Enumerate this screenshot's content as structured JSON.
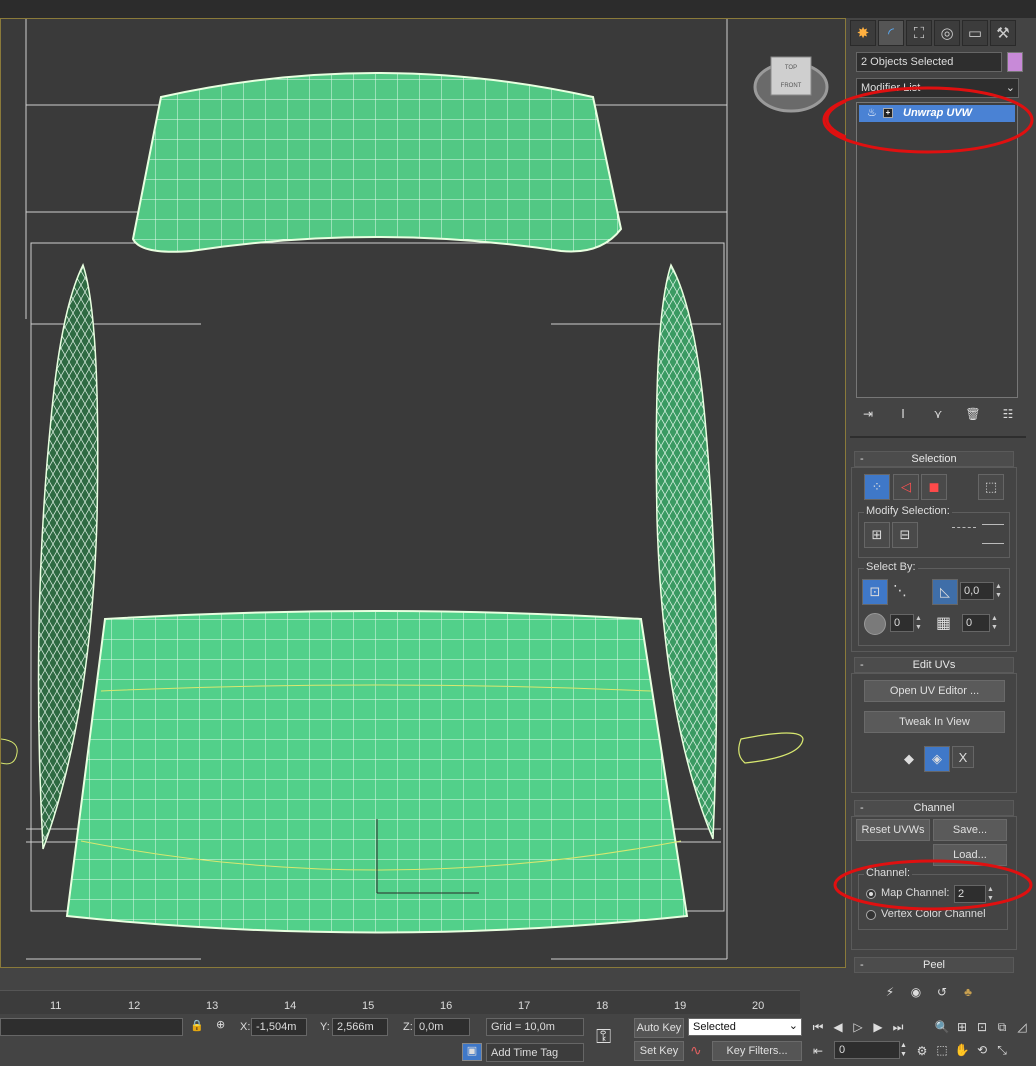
{
  "command_panel": {
    "tabs": [
      "create-tab",
      "modify-tab",
      "hierarchy-tab",
      "motion-tab",
      "display-tab",
      "utilities-tab"
    ],
    "selection_name": "2 Objects Selected",
    "selection_color": "#c88ad8",
    "modifier_list_label": "Modifier List",
    "stack_item": "Unwrap UVW",
    "selection_rollout": {
      "title": "Selection",
      "modify_selection_label": "Modify Selection:",
      "select_by_label": "Select By:",
      "angle_value": "0,0",
      "spinner_a": "0",
      "spinner_b": "0"
    },
    "edit_uvs_rollout": {
      "title": "Edit UVs",
      "open_uv_editor": "Open UV Editor ...",
      "tweak_in_view": "Tweak In View"
    },
    "channel_rollout": {
      "title": "Channel",
      "reset_uvws": "Reset UVWs",
      "save": "Save...",
      "load": "Load...",
      "channel_group_label": "Channel:",
      "map_channel_label": "Map Channel:",
      "map_channel_value": "2",
      "vertex_color_label": "Vertex Color Channel"
    },
    "peel_rollout": {
      "title": "Peel"
    }
  },
  "viewport": {
    "viewcube_top": "TOP",
    "viewcube_front": "FRONT",
    "mesh_color": "#52d08a",
    "annotation_color": "#e01010"
  },
  "timeline": {
    "ticks": [
      "11",
      "12",
      "13",
      "14",
      "15",
      "16",
      "17",
      "18",
      "19",
      "20"
    ]
  },
  "statusbar": {
    "x_label": "X:",
    "x_value": "-1,504m",
    "y_label": "Y:",
    "y_value": "2,566m",
    "z_label": "Z:",
    "z_value": "0,0m",
    "grid": "Grid = 10,0m",
    "add_time_tag": "Add Time Tag",
    "auto_key": "Auto Key",
    "set_key": "Set Key",
    "key_mode_value": "Selected",
    "key_filters": "Key Filters...",
    "frame_value": "0"
  }
}
